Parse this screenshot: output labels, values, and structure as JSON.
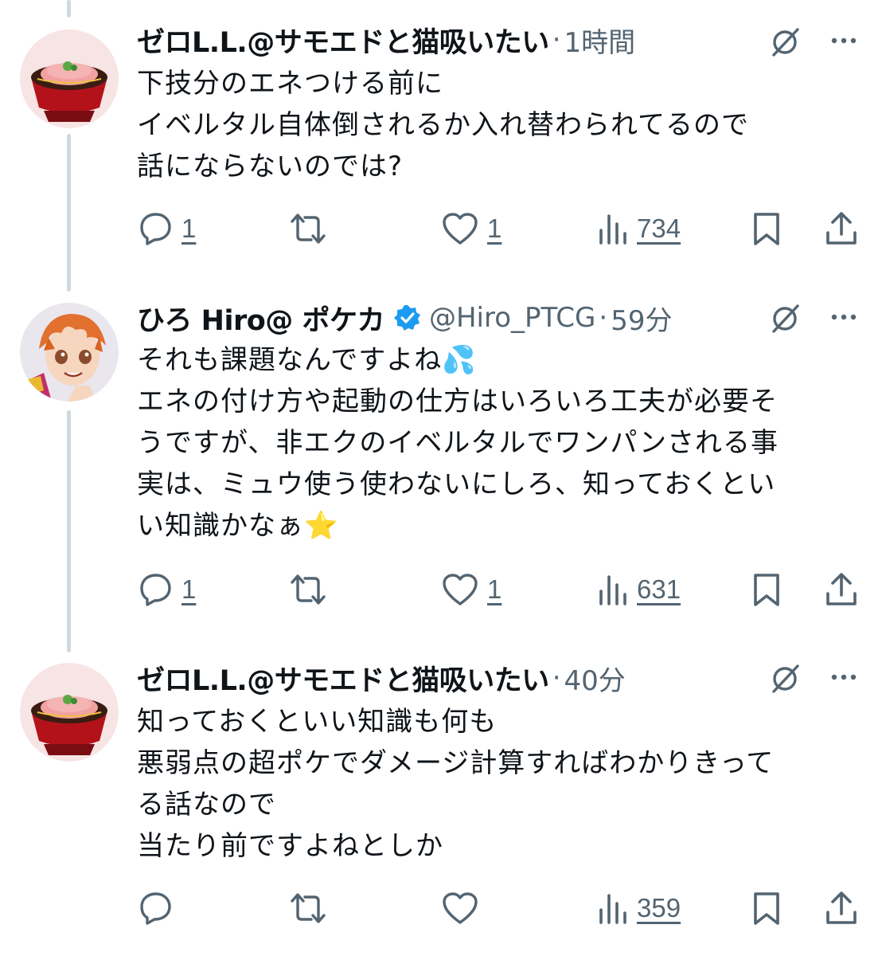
{
  "tweets": [
    {
      "name": "ゼロL.L.@サモエドと猫吸いたい",
      "handle": "",
      "dot": "·",
      "time": "1時間",
      "lines": [
        "下技分のエネつける前に",
        "イベルタル自体倒されるか入れ替わられてるので",
        "話にならないのでは?"
      ],
      "replies": "1",
      "likes": "1",
      "views": "734"
    },
    {
      "name": "ひろ Hiro@ ポケカ",
      "handle": "@Hiro_PTCG",
      "dot": "·",
      "time": "59分",
      "lines": [
        "それも課題なんですよね💦",
        "エネの付け方や起動の仕方はいろいろ工夫が必要そ",
        "うですが、非エクのイベルタルでワンパンされる事",
        "実は、ミュウ使う使わないにしろ、知っておくとい",
        "い知識かなぁ⭐"
      ],
      "replies": "1",
      "likes": "1",
      "views": "631"
    },
    {
      "name": "ゼロL.L.@サモエドと猫吸いたい",
      "handle": "",
      "dot": "·",
      "time": "40分",
      "lines": [
        "知っておくといい知識も何も",
        "悪弱点の超ポケでダメージ計算すればわかりきって",
        "る話なので",
        "当たり前ですよねとしか"
      ],
      "replies": "",
      "likes": "",
      "views": "359"
    }
  ],
  "colors": {
    "text": "#0f1419",
    "secondary": "#536471",
    "verified": "#1d9bf0",
    "thread_line": "#cfd9de"
  }
}
